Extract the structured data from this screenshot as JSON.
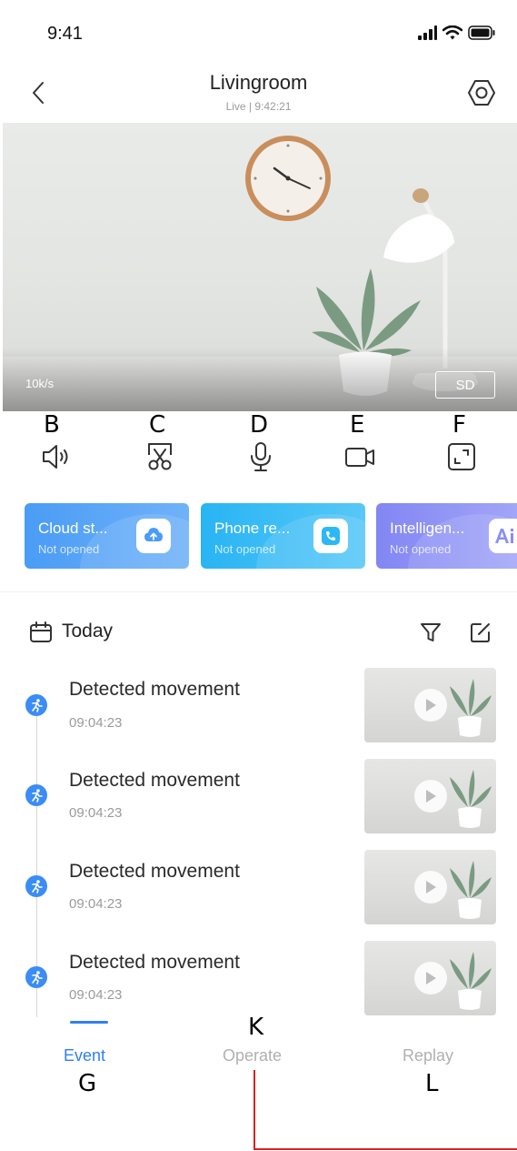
{
  "status_bar": {
    "time": "9:41"
  },
  "header": {
    "title": "Livingroom",
    "subtitle": "Live | 9:42:21"
  },
  "video": {
    "bitrate": "10k/s",
    "quality_label": "SD"
  },
  "annotations": {
    "b": "B",
    "c": "C",
    "d": "D",
    "e": "E",
    "f": "F",
    "g": "G",
    "k": "K",
    "l": "L"
  },
  "controls": [
    {
      "icon": "speaker-icon"
    },
    {
      "icon": "scissors-icon"
    },
    {
      "icon": "microphone-icon"
    },
    {
      "icon": "video-record-icon"
    },
    {
      "icon": "fullscreen-icon"
    }
  ],
  "cards": [
    {
      "title": "Cloud st...",
      "status": "Not opened",
      "icon": "cloud-upload-icon",
      "color": "#4a9cf6"
    },
    {
      "title": "Phone re...",
      "status": "Not opened",
      "icon": "phone-icon",
      "color": "#2bb8f5"
    },
    {
      "title": "Intelligen...",
      "status": "Not opened",
      "icon": "ai-icon",
      "color": "#8a8ef5"
    }
  ],
  "today": {
    "label": "Today"
  },
  "events": [
    {
      "title": "Detected movement",
      "time": "09:04:23"
    },
    {
      "title": "Detected movement",
      "time": "09:04:23"
    },
    {
      "title": "Detected movement",
      "time": "09:04:23"
    },
    {
      "title": "Detected movement",
      "time": "09:04:23"
    }
  ],
  "tabs": [
    {
      "label": "Event",
      "active": true
    },
    {
      "label": "Operate",
      "active": false
    },
    {
      "label": "Replay",
      "active": false
    }
  ],
  "colors": {
    "accent": "#2f7ff2",
    "event_dot": "#3b8cf5",
    "annotation_line": "#d9231f"
  }
}
